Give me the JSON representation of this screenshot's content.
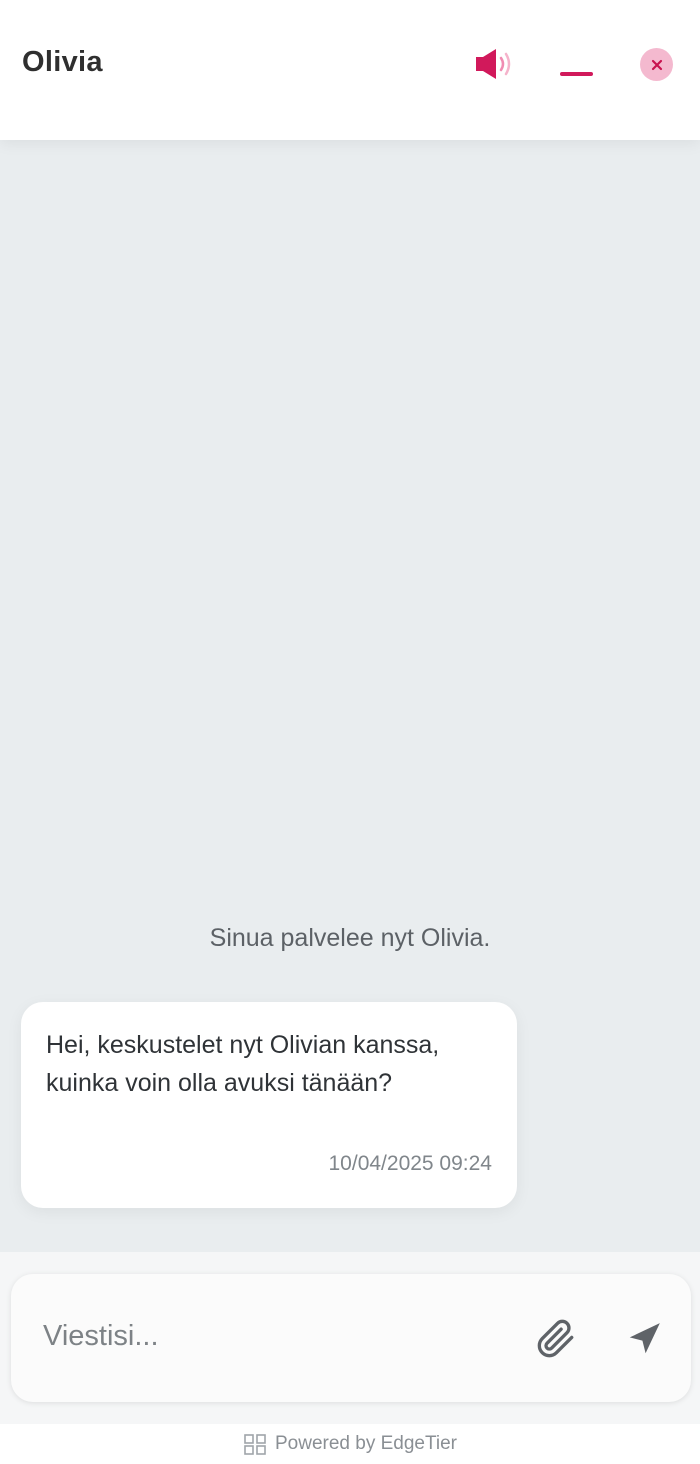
{
  "header": {
    "agent_name": "Olivia"
  },
  "messages": {
    "system_notice": "Sinua palvelee nyt Olivia.",
    "items": [
      {
        "text": "Hei, keskustelet nyt Olivian kanssa, kuinka voin olla avuksi tänään?",
        "timestamp": "10/04/2025 09:24"
      }
    ]
  },
  "composer": {
    "placeholder": "Viestisi..."
  },
  "footer": {
    "powered_by": "Powered by EdgeTier"
  },
  "icons": {
    "sound": "speaker-icon",
    "minimize": "minimize-icon",
    "close": "close-icon",
    "attach": "paperclip-icon",
    "send": "send-arrow-icon",
    "brand": "edgetier-logo-icon"
  },
  "colors": {
    "accent": "#d1195b",
    "close_bg": "#f4b9cf",
    "messages_bg": "#e9edef",
    "icon_gray": "#5f6368"
  }
}
